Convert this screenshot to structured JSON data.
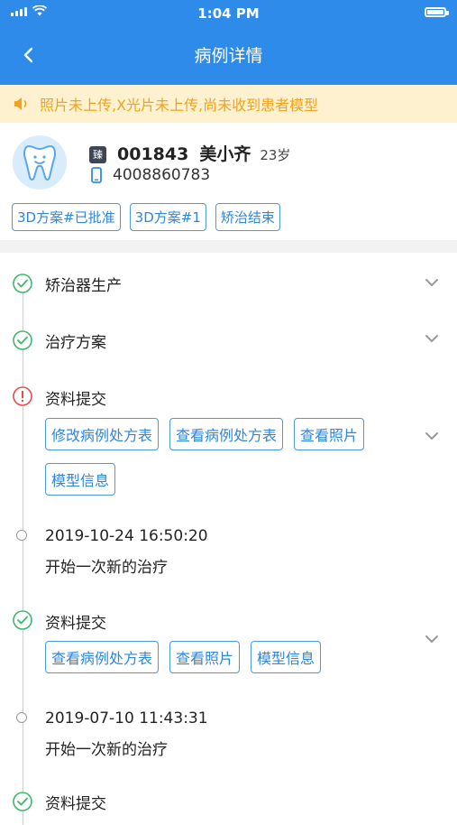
{
  "status_bar": {
    "time": "1:04 PM"
  },
  "nav": {
    "title": "病例详情"
  },
  "warning": {
    "text": "照片未上传,X光片未上传,尚未收到患者模型"
  },
  "patient": {
    "badge": "臻",
    "id": "001843",
    "name": "美小齐",
    "age": "23岁",
    "phone": "4008860783",
    "tags": [
      "3D方案#已批准",
      "3D方案#1",
      "矫治结束"
    ]
  },
  "timeline": {
    "item1": {
      "label": "矫治器生产"
    },
    "item2": {
      "label": "治疗方案"
    },
    "item3": {
      "label": "资料提交",
      "buttons": [
        "修改病例处方表",
        "查看病例处方表",
        "查看照片",
        "模型信息"
      ]
    },
    "event1": {
      "datetime": "2019-10-24 16:50:20",
      "text": "开始一次新的治疗"
    },
    "item4": {
      "label": "资料提交",
      "buttons": [
        "查看病例处方表",
        "查看照片",
        "模型信息"
      ]
    },
    "event2": {
      "datetime": "2019-07-10 11:43:31",
      "text": "开始一次新的治疗"
    },
    "item5": {
      "label": "资料提交"
    }
  },
  "colors": {
    "primary": "#2f8bea",
    "warning_bg": "#fdf1cf",
    "warning_text": "#f2a21b",
    "success": "#3cb96b",
    "error": "#e94b4b"
  },
  "icons": [
    "back-icon",
    "speaker-icon",
    "tooth-avatar-icon",
    "phone-icon",
    "check-circle-icon",
    "error-circle-icon",
    "chevron-down-icon"
  ]
}
